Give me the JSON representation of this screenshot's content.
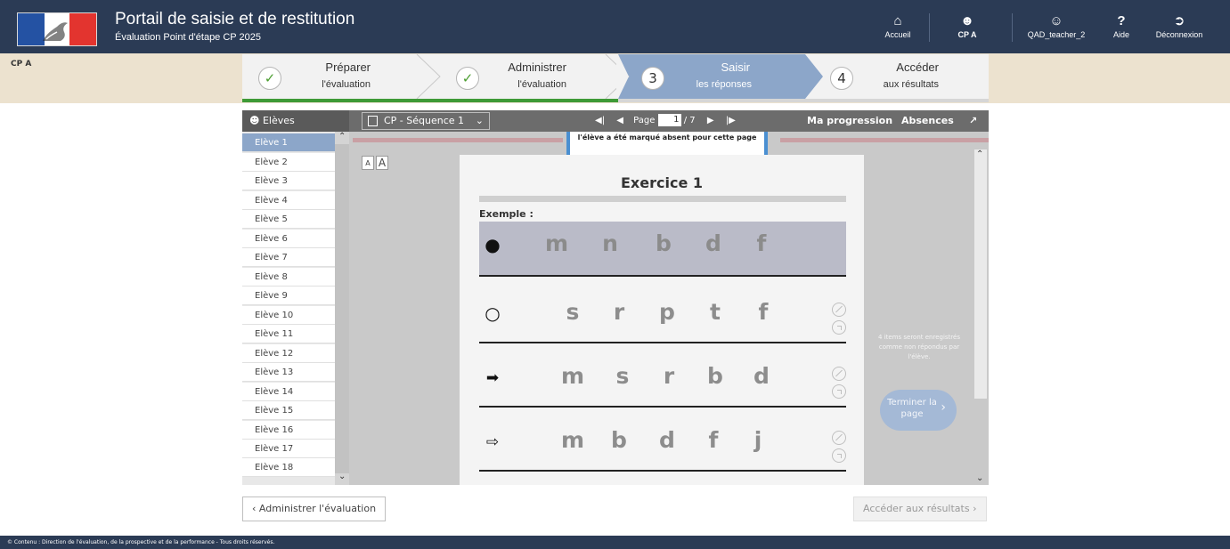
{
  "header": {
    "title": "Portail de saisie et de restitution",
    "subtitle": "Évaluation Point d'étape CP 2025",
    "nav": [
      {
        "label": "Accueil",
        "icon": "home-icon"
      },
      {
        "label": "CP A",
        "icon": "group-icon"
      },
      {
        "label": "QAD_teacher_2",
        "icon": "user-icon"
      },
      {
        "label": "Aide",
        "icon": "help-icon"
      },
      {
        "label": "Déconnexion",
        "icon": "logout-icon"
      }
    ]
  },
  "class_label": "CP A",
  "stepper": {
    "steps": [
      {
        "title": "Préparer",
        "subtitle": "l'évaluation",
        "marker": "✓",
        "state": "done"
      },
      {
        "title": "Administrer",
        "subtitle": "l'évaluation",
        "marker": "✓",
        "state": "done"
      },
      {
        "title": "Saisir",
        "subtitle": "les réponses",
        "marker": "3",
        "state": "active"
      },
      {
        "title": "Accéder",
        "subtitle": "aux résultats",
        "marker": "4",
        "state": "todo"
      }
    ]
  },
  "toolbar": {
    "students_label": "Elèves",
    "sequence": "CP - Séquence 1",
    "page_label": "Page",
    "page_current": "1",
    "page_total": "/ 7",
    "progress_label": "Ma progression",
    "absences_label": "Absences"
  },
  "students": [
    "Elève 1",
    "Elève 2",
    "Elève 3",
    "Elève 4",
    "Elève 5",
    "Elève 6",
    "Elève 7",
    "Elève 8",
    "Elève 9",
    "Elève 10",
    "Elève 11",
    "Elève 12",
    "Elève 13",
    "Elève 14",
    "Elève 15",
    "Elève 16",
    "Elève 17",
    "Elève 18"
  ],
  "selected_student": "Elève 1",
  "absent_notice": "l'élève a été marqué absent pour cette page",
  "font_buttons": [
    "A",
    "A"
  ],
  "exercise": {
    "title": "Exercice 1",
    "example_label": "Exemple :",
    "rows": [
      {
        "symbol": "●",
        "letters": [
          "m",
          "n",
          "b",
          "d",
          "f"
        ],
        "example": true
      },
      {
        "symbol": "○",
        "letters": [
          "s",
          "r",
          "p",
          "t",
          "f"
        ],
        "example": false
      },
      {
        "symbol": "➡",
        "letters": [
          "m",
          "s",
          "r",
          "b",
          "d"
        ],
        "example": false
      },
      {
        "symbol": "⇨",
        "letters": [
          "m",
          "b",
          "d",
          "f",
          "j"
        ],
        "example": false
      }
    ]
  },
  "side_info": "4 items seront enregistrés comme non répondus par l'élève.",
  "finish_button": "Terminer la page",
  "buttons": {
    "back": "Administrer l'évaluation",
    "results": "Accéder aux résultats"
  },
  "footer": "© Contenu : Direction de l'évaluation, de la prospective et de la performance - Tous droits réservés."
}
